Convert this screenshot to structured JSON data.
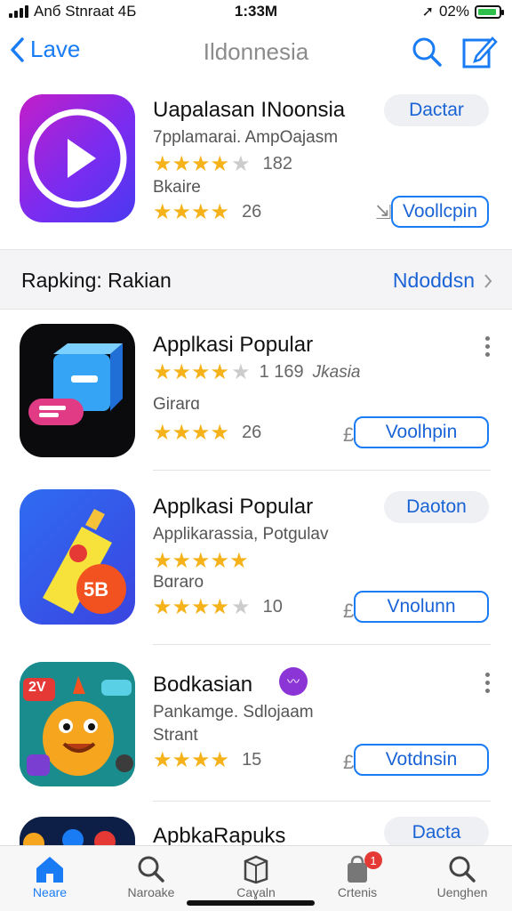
{
  "status": {
    "carrier": "Anб Stnraat 4Б",
    "time": "1:33M",
    "battery_text": "02%",
    "battery_level": 0.9
  },
  "nav": {
    "back_label": "Lave",
    "title": "Ildonnesia"
  },
  "featured": {
    "name": "Uapalasan INoonsia",
    "subtitle": "7pplamarai. AmpOajasm",
    "rating_count": "182",
    "category": "Bkaire",
    "rating_count_2": "26",
    "action_top": "Dactar",
    "action_bottom": "Voollcpin"
  },
  "section": {
    "label": "Rapking: Rakian",
    "link": "Ndoddsn"
  },
  "apps": [
    {
      "name": "Applkasi Popular",
      "subtitle_count": "1 169",
      "subtitle": "Jkasia",
      "category": "Girarɑ",
      "rating_count": "26",
      "action": "Voolhpin"
    },
    {
      "name": "Applkasi Popular",
      "subtitle": "Applikarassia, Potgulav",
      "category": "Bɑraro",
      "rating_count": "10",
      "action_top": "Daoton",
      "action": "Vnolunn",
      "icon_text": "5B"
    },
    {
      "name": "Bodkasian",
      "subtitle": "Pankamge. Sdlojaam",
      "category": "Strant",
      "rating_count": "15",
      "action": "Votdnsin",
      "icon_text": "2V"
    },
    {
      "name": "ApbkaRapuks",
      "action_top": "Dacta"
    }
  ],
  "tabs": [
    {
      "label": "Neare",
      "icon": "home-icon",
      "active": true
    },
    {
      "label": "Naroake",
      "icon": "search-icon"
    },
    {
      "label": "Caɣaln",
      "icon": "box-icon"
    },
    {
      "label": "Crtenis",
      "icon": "shopping-bag-icon",
      "badge": "1"
    },
    {
      "label": "Uenghen",
      "icon": "search-icon"
    }
  ],
  "colors": {
    "accent": "#1a7cf5",
    "star": "#f5b21a"
  }
}
